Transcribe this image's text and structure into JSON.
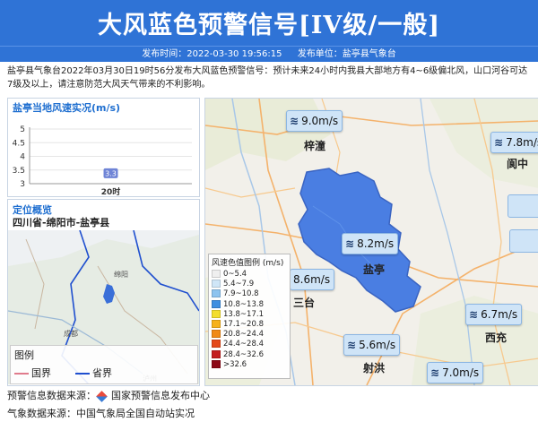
{
  "header": {
    "title": "大风蓝色预警信号[IV级/一般]",
    "publish_time_label": "发布时间：",
    "publish_time": "2022-03-30 19:56:15",
    "publish_unit_label": "发布单位：",
    "publish_unit": "盐亭县气象台"
  },
  "description": "盐亭县气象台2022年03月30日19时56分发布大风蓝色预警信号：预计未来24小时内我县大部地方有4~6级偏北风，山口河谷可达7级及以上，请注意防范大风天气带来的不利影响。",
  "wind_panel": {
    "title": "盐亭当地风速实况(m/s)",
    "chart_data": {
      "type": "scatter",
      "title": "盐亭当地风速实况(m/s)",
      "categories": [
        "20时"
      ],
      "values": [
        3.3
      ],
      "ylim": [
        3,
        5
      ],
      "yticks": [
        3,
        3.5,
        4,
        4.5,
        5
      ],
      "ytick_labels": [
        "3",
        "3.5",
        "4",
        "4.5",
        "5"
      ],
      "data_label": "3.3",
      "marker_color": "#6f84d6"
    }
  },
  "location_panel": {
    "title": "定位概览",
    "location": "四川省-绵阳市-盐亭县",
    "map_labels": [
      "绵阳",
      "成都",
      "泸州"
    ],
    "legend_title": "图例",
    "legend_items": [
      {
        "label": "国界",
        "color": "#e07b8c"
      },
      {
        "label": "省界",
        "color": "#1f4fcf"
      }
    ]
  },
  "main_map": {
    "labels": {
      "zitong": "梓潼",
      "yanting": "盐亭",
      "santai": "三台",
      "langzhong": "阆中",
      "xichong": "西充",
      "shehong": "射洪"
    },
    "wind_readings": [
      {
        "id": "zitong",
        "value": "9.0m/s"
      },
      {
        "id": "langzhong",
        "value": "7.8m/s"
      },
      {
        "id": "yanting",
        "value": "8.2m/s"
      },
      {
        "id": "santai",
        "value": "8.6m/s"
      },
      {
        "id": "xichong",
        "value": "6.7m/s"
      },
      {
        "id": "shehong",
        "value": "5.6m/s"
      },
      {
        "id": "south",
        "value": "7.0m/s"
      }
    ],
    "county_fill": "#4a7ee2",
    "legend": {
      "title": "风速色值图例 (m/s)",
      "items": [
        {
          "label": "0~5.4",
          "color": "#efefef"
        },
        {
          "label": "5.4~7.9",
          "color": "#cfe6f7"
        },
        {
          "label": "7.9~10.8",
          "color": "#8ec4ef"
        },
        {
          "label": "10.8~13.8",
          "color": "#3f8fe0"
        },
        {
          "label": "13.8~17.1",
          "color": "#f3de2c"
        },
        {
          "label": "17.1~20.8",
          "color": "#f6b21a"
        },
        {
          "label": "20.8~24.4",
          "color": "#f08a16"
        },
        {
          "label": "24.4~28.4",
          "color": "#e44a19"
        },
        {
          "label": "28.4~32.6",
          "color": "#c41f1f"
        },
        {
          "label": ">32.6",
          "color": "#8c0a16"
        }
      ]
    }
  },
  "footer": {
    "warning_source_label": "预警信息数据来源：",
    "warning_source": "国家预警信息发布中心",
    "weather_source_label": "气象数据来源：",
    "weather_source": "中国气象局全国自动站实况"
  }
}
